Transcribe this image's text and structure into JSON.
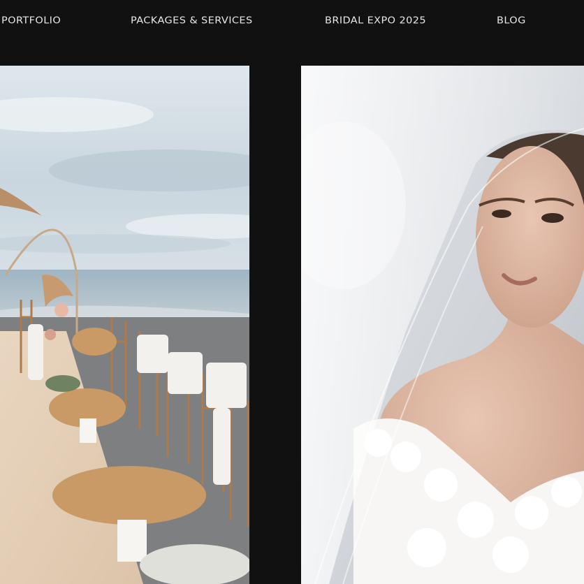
{
  "nav": {
    "items": [
      {
        "label": "PORTFOLIO"
      },
      {
        "label": "PACKAGES & SERVICES"
      },
      {
        "label": "BRIDAL EXPO 2025"
      },
      {
        "label": "BLOG"
      }
    ]
  },
  "colors": {
    "background": "#111112",
    "nav_text": "#e6e6e6"
  }
}
